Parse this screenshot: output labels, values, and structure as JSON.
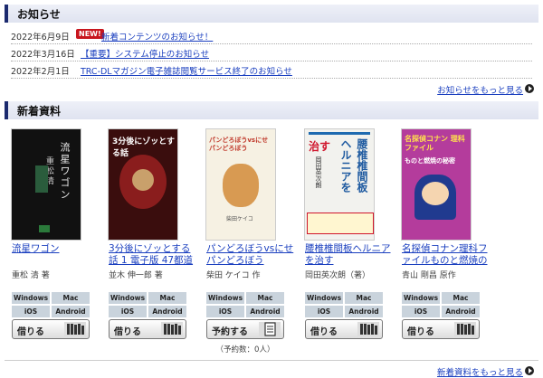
{
  "news": {
    "header": "お知らせ",
    "items": [
      {
        "date": "2022年6月9日",
        "badge": "NEW!",
        "title": "新着コンテンツのお知らせ！"
      },
      {
        "date": "2022年3月16日",
        "badge": "",
        "title": "【重要】システム停止のお知らせ"
      },
      {
        "date": "2022年2月1日",
        "badge": "",
        "title": "TRC-DLマガジン電子雑誌閲覧サービス終了のお知らせ"
      }
    ],
    "more": "お知らせをもっと見る"
  },
  "new_materials": {
    "header": "新着資料",
    "more": "新着資料をもっと見る",
    "platforms": [
      "Windows",
      "Mac",
      "iOS",
      "Android"
    ],
    "books": [
      {
        "title": "流星ワゴン",
        "author": "重松 清 著",
        "action": "借りる",
        "action_icon": "bookshelf-icon",
        "cover_text": [
          "流星ワゴン",
          "重松清"
        ],
        "cover_bg": "#1a1a1a"
      },
      {
        "title": "3分後にゾッとする話 1 電子版 47都道",
        "author": "並木 伸一郎 著",
        "action": "借りる",
        "action_icon": "bookshelf-icon",
        "cover_text": [
          "3分後にゾッとする話"
        ],
        "cover_bg": "#3a0d0d"
      },
      {
        "title": "パンどろぼうvsにせパンどろぼう",
        "author": "柴田 ケイコ 作",
        "action": "予約する",
        "action_icon": "reserve-icon",
        "reserve_count": "（予約数：0人）",
        "cover_text": [
          "パンどろぼうvsにせパンどろぼう",
          "柴田ケイコ"
        ],
        "cover_bg": "#f6f1e3"
      },
      {
        "title": "腰椎椎間板ヘルニアを治す",
        "author": "岡田英次朗（著）",
        "action": "借りる",
        "action_icon": "bookshelf-icon",
        "cover_text": [
          "腰椎椎間板",
          "ヘルニアを",
          "治す",
          "岡田英次朗"
        ],
        "cover_bg": "#f2f2ee"
      },
      {
        "title": "名探偵コナン理科ファイルものと燃焼の",
        "author": "青山 剛昌 原作",
        "action": "借りる",
        "action_icon": "bookshelf-icon",
        "cover_text": [
          "名探偵コナン 理科ファイル",
          "ものと燃焼の秘密"
        ],
        "cover_bg": "#b43c9c"
      }
    ]
  }
}
